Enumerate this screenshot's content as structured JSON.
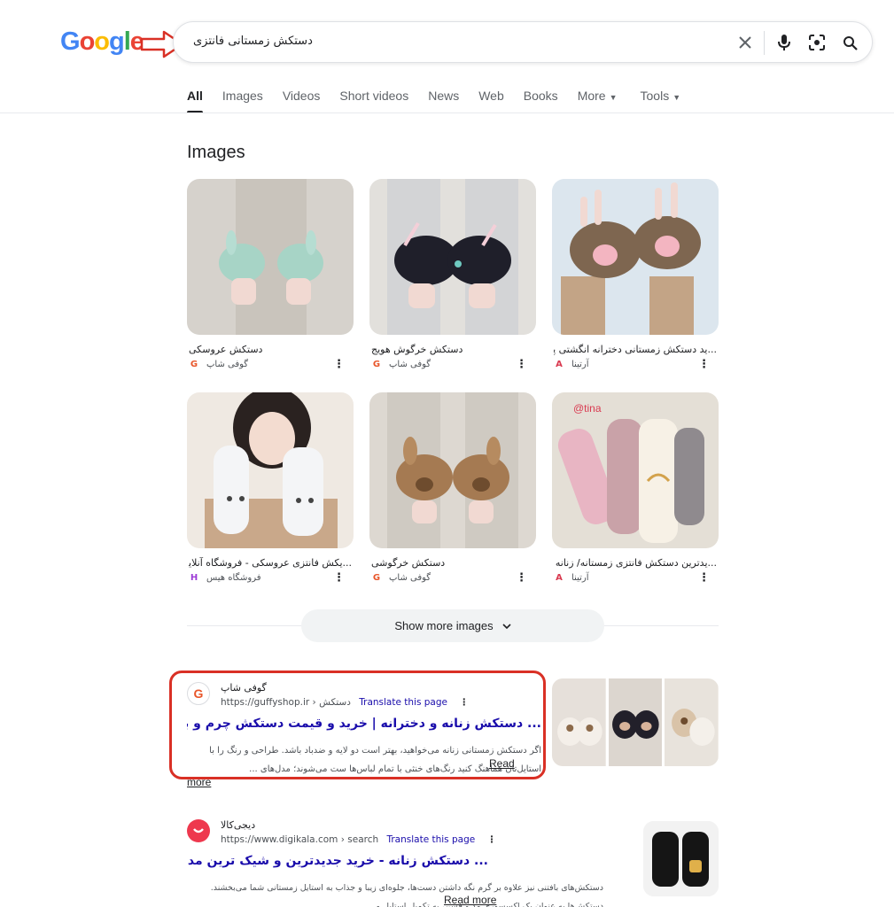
{
  "logo": "Google",
  "search": {
    "query": "دستکش زمستانی فانتزی"
  },
  "tabs": {
    "all": "All",
    "images": "Images",
    "videos": "Videos",
    "short_videos": "Short videos",
    "news": "News",
    "web": "Web",
    "books": "Books",
    "more": "More",
    "tools": "Tools"
  },
  "images_section": {
    "heading": "Images",
    "items": [
      {
        "title": "دستکش عروسکی",
        "source": "گوفی شاپ",
        "source_icon": "G"
      },
      {
        "title": "دستکش خرگوش هویج",
        "source": "گوفی شاپ",
        "source_icon": "G"
      },
      {
        "title": "...ید دستکش زمستانی دخترانه انگشتی پشما",
        "source": "آرتینا",
        "source_icon": "A"
      },
      {
        "title": "...یکش فانتزی عروسکی - فروشگاه آنلاین",
        "source": "فروشگاه هیس",
        "source_icon": "H"
      },
      {
        "title": "دستکش خرگوشی",
        "source": "گوفی شاپ",
        "source_icon": "G"
      },
      {
        "title": "...یدترین دستکش فانتزی زمستانه/ زنانه و د",
        "source": "آرتینا",
        "source_icon": "A"
      }
    ],
    "show_more": "Show more images"
  },
  "results": [
    {
      "site": "گوفی شاپ",
      "url": "https://guffyshop.ir › دستکش",
      "translate": "Translate this page",
      "title": "... دستکش زنانه و دخترانه | خرید و قیمت دستکش چرم و بافتنی و",
      "snippet_line1": "اگر دستکش زمستانی زنانه می‌خواهید، بهتر است دو لایه و ضدباد باشد. طراحی و رنگ را با",
      "snippet_line2": "استایل‌تان هماهنگ کنید رنگ‌های خنثی با تمام لباس‌ها ست می‌شوند؛ مدل‌های ...",
      "read": "Read",
      "more": "more",
      "favicon": "G"
    },
    {
      "site": "دیجی‌کالا",
      "url": "https://www.digikala.com › search",
      "translate": "Translate this page",
      "title": "... دستکش زنانه - خرید جدیدترین و شیک ترین مدل های",
      "snippet_line1": "دستکش‌های بافتنی نیز علاوه بر گرم نگه داشتن دست‌ها، جلوه‌ای زیبا و جذاب به استایل زمستانی شما می‌بخشند.",
      "snippet_line2": "دستکش‌ها به عنوان یک اکسسوری مد و فشن، به تکمیل استایل و ...",
      "read_more": "Read more"
    }
  ],
  "colors": {
    "link": "#1a0dab",
    "highlight": "#d93025",
    "arrow": "#d93025"
  }
}
